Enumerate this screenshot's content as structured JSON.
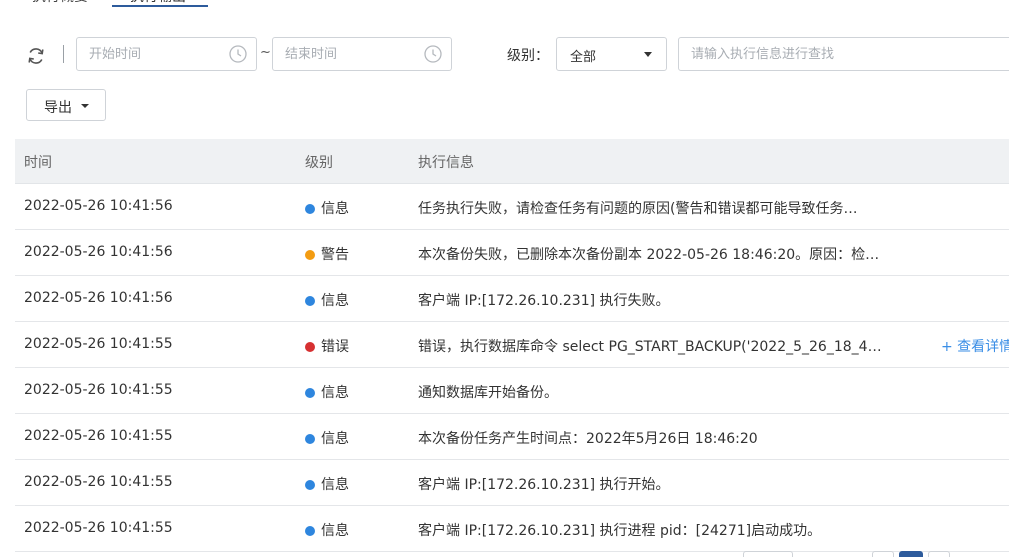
{
  "tabs": [
    {
      "label": "执行概要"
    },
    {
      "label": "执行输出"
    }
  ],
  "filters": {
    "start_placeholder": "开始时间",
    "end_placeholder": "结束时间",
    "range_sep": "~",
    "level_label": "级别：",
    "level_value": "全部",
    "search_placeholder": "请输入执行信息进行查找"
  },
  "toolbar": {
    "export_label": "导出"
  },
  "table": {
    "headers": {
      "time": "时间",
      "level": "级别",
      "message": "执行信息"
    },
    "detail_link": "+ 查看详情",
    "rows": [
      {
        "time": "2022-05-26 10:41:56",
        "level": "信息",
        "color": "#2e86de",
        "message": "任务执行失败，请检查任务有问题的原因(警告和错误都可能导致任务…"
      },
      {
        "time": "2022-05-26 10:41:56",
        "level": "警告",
        "color": "#f39c12",
        "message": "本次备份失败，已删除本次备份副本 2022-05-26 18:46:20。原因：检…"
      },
      {
        "time": "2022-05-26 10:41:56",
        "level": "信息",
        "color": "#2e86de",
        "message": "客户端 IP:[172.26.10.231] 执行失败。"
      },
      {
        "time": "2022-05-26 10:41:55",
        "level": "错误",
        "color": "#d63031",
        "message": "错误，执行数据库命令 select PG_START_BACKUP('2022_5_26_18_4…",
        "has_detail": true
      },
      {
        "time": "2022-05-26 10:41:55",
        "level": "信息",
        "color": "#2e86de",
        "message": "通知数据库开始备份。"
      },
      {
        "time": "2022-05-26 10:41:55",
        "level": "信息",
        "color": "#2e86de",
        "message": "本次备份任务产生时间点：2022年5月26日 18:46:20"
      },
      {
        "time": "2022-05-26 10:41:55",
        "level": "信息",
        "color": "#2e86de",
        "message": "客户端 IP:[172.26.10.231] 执行开始。"
      },
      {
        "time": "2022-05-26 10:41:55",
        "level": "信息",
        "color": "#2e86de",
        "message": "客户端 IP:[172.26.10.231] 执行进程 pid：[24271]启动成功。"
      }
    ]
  },
  "icons": {
    "refresh": "refresh-icon",
    "clock": "clock-icon",
    "caret": "caret-down-icon"
  }
}
